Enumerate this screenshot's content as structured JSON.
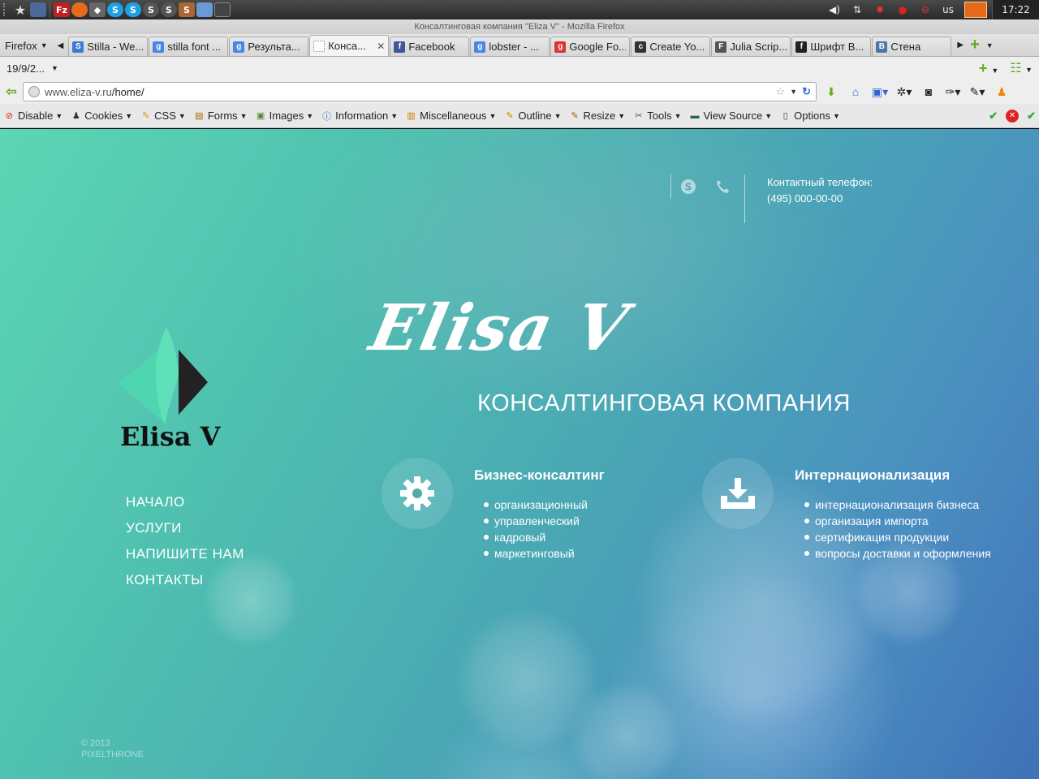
{
  "panel": {
    "clock": "17:22",
    "lang": "us"
  },
  "window": {
    "title": "Консалтинговая компания \"Eliza V\" - Mozilla Firefox"
  },
  "firefox_menu": "Firefox",
  "tabs": [
    {
      "label": "Stilla - We...",
      "color": "#3a7bd5",
      "icon": "S"
    },
    {
      "label": "stilla font ...",
      "color": "#4a86e8",
      "icon": "g"
    },
    {
      "label": "Результа...",
      "color": "#4a86e8",
      "icon": "g"
    },
    {
      "label": "Конса...",
      "color": "#ffffff",
      "icon": ""
    },
    {
      "label": "Facebook",
      "color": "#3b5998",
      "icon": "f"
    },
    {
      "label": "lobster - ...",
      "color": "#4a86e8",
      "icon": "g"
    },
    {
      "label": "Google Fo...",
      "color": "#d33",
      "icon": "g"
    },
    {
      "label": "Create Yo...",
      "color": "#333",
      "icon": "c"
    },
    {
      "label": "Julia Scrip...",
      "color": "#555",
      "icon": "F"
    },
    {
      "label": "Шрифт В...",
      "color": "#222",
      "icon": "f"
    },
    {
      "label": "Стена",
      "color": "#4a76a8",
      "icon": "B"
    }
  ],
  "bookmark_folder": "19/9/2...",
  "url": {
    "host": "www.eliza-v.ru",
    "path": "/home/"
  },
  "devbar": [
    {
      "label": "Disable",
      "icon": "⊘",
      "color": "#d22"
    },
    {
      "label": "Cookies",
      "icon": "♟",
      "color": "#333"
    },
    {
      "label": "CSS",
      "icon": "✎",
      "color": "#c90"
    },
    {
      "label": "Forms",
      "icon": "▤",
      "color": "#a60"
    },
    {
      "label": "Images",
      "icon": "▣",
      "color": "#583"
    },
    {
      "label": "Information",
      "icon": "ⓘ",
      "color": "#26c"
    },
    {
      "label": "Miscellaneous",
      "icon": "▥",
      "color": "#c70"
    },
    {
      "label": "Outline",
      "icon": "✎",
      "color": "#c80"
    },
    {
      "label": "Resize",
      "icon": "✎",
      "color": "#a50"
    },
    {
      "label": "Tools",
      "icon": "✂",
      "color": "#555"
    },
    {
      "label": "View Source",
      "icon": "▬",
      "color": "#264"
    },
    {
      "label": "Options",
      "icon": "▯",
      "color": "#444"
    }
  ],
  "site": {
    "phone_label": "Контактный телефон:",
    "phone": "(495) 000-00-00",
    "script_title": "Elisa V",
    "subtitle": "КОНСАЛТИНГОВАЯ КОМПАНИЯ",
    "logo_text": "Elisa V",
    "nav": [
      "НАЧАЛО",
      "УСЛУГИ",
      "НАПИШИТЕ НАМ",
      "КОНТАКТЫ"
    ],
    "services": [
      {
        "title": "Бизнес-консалтинг",
        "icon": "gear-icon",
        "items": [
          "организационный",
          "управленческий",
          "кадровый",
          "маркетинговый"
        ]
      },
      {
        "title": "Интернационализация",
        "icon": "download-icon",
        "items": [
          "интернационализация бизнеса",
          "организация импорта",
          "сертификация продукции",
          "вопросы доставки и оформления"
        ]
      }
    ],
    "footer_year": "© 2013",
    "footer_brand": "PIXELTHRONE"
  }
}
